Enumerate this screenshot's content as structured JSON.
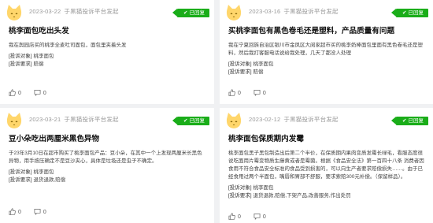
{
  "colors": {
    "badge": "#1aad19",
    "avatar": "#ffd66b"
  },
  "cards": [
    {
      "date": "2023-03-22",
      "source": "于黑猫投诉平台发起",
      "badge": "已回复",
      "title": "桃李面包吃出头发",
      "content": "我在舆园店买的桃李全麦吐司面包，面包里夹着头发",
      "object_label": "[投诉对象]",
      "object": "桃李面包",
      "demand_label": "[投诉要求]",
      "demand": "赔偿",
      "likes": "0",
      "comments": "0"
    },
    {
      "date": "2023-03-16",
      "source": "于黑猫投诉平台发起",
      "badge": "已回复",
      "title": "买桃李面包有黑色卷毛还是塑料，产品质量有问题",
      "content": "我在宁夏回族自治区银川市金凤区大阅家超市买的桃李奶棒面包里面有黑色卷毛还是塑料，然后我打客服电话说给我处理，几天了都没人处理",
      "object_label": "[投诉对象]",
      "object": "桃李面包",
      "demand_label": "[投诉要求]",
      "demand": "赔偿",
      "likes": "0",
      "comments": "0"
    },
    {
      "date": "2023-03-21",
      "source": "于黑猫投诉平台发起",
      "badge": "已回复",
      "title": "豆小朵吃出两厘米黑色异物",
      "content": "于23年3月10日在超市购买了桃李面包产品：豆小朵，在其中一个上发现两厘米长黑色异物，用手按压确定不是豆沙夹心，具体是垃圾还是虫子不确定。",
      "object_label": "[投诉对象]",
      "object": "桃李面包",
      "demand_label": "[投诉要求]",
      "demand": "退货退款,赔偿",
      "likes": "0",
      "comments": "0"
    },
    {
      "date": "2023-02-12",
      "source": "于黑猫投诉平台发起",
      "badge": "已回复",
      "title": "桃李面包保质期内发霉",
      "content": "桃李面包黑子黑包制造出后第二个半价，在保质期内果肉变质发霉长绿毛，看服态度很说吃面用片霉变物质生藤黄或者是霉菌。根据《食品安全法》第一百四十八条 消费者因食用不符合食品安全标准的食品受到损害的，可以向生产者要求赔偿损失……。由于已经食用过两个半面包，嘴唇和胃部不舒服，要求索赔300元补偿。（保留样品）。",
      "object_label": "[投诉对象]",
      "object": "桃李面包",
      "demand_label": "[投诉要求]",
      "demand": "退货退款,赔偿,下架产品,改善服务,作出处罚",
      "likes": "0",
      "comments": "0"
    }
  ]
}
